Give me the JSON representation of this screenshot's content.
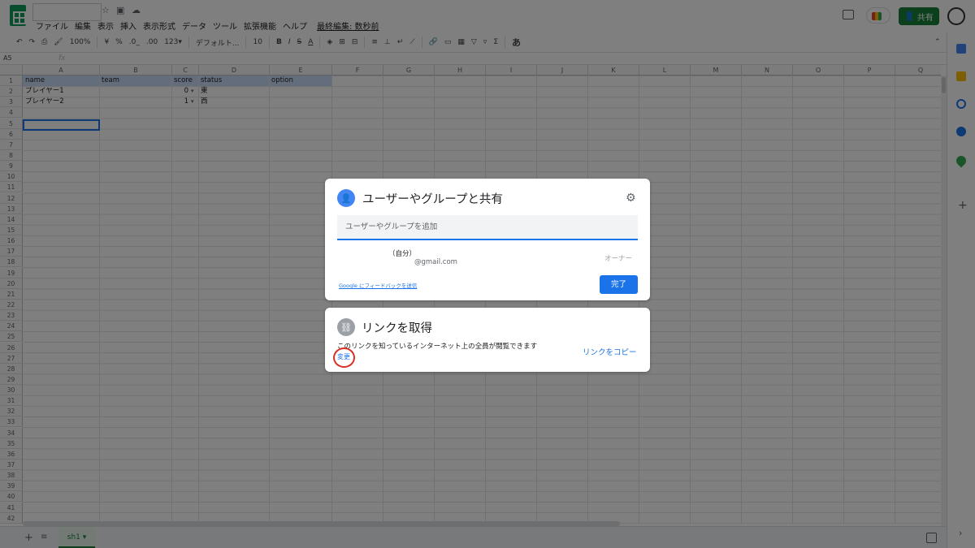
{
  "app": {
    "menu": [
      "ファイル",
      "編集",
      "表示",
      "挿入",
      "表示形式",
      "データ",
      "ツール",
      "拡張機能",
      "ヘルプ"
    ],
    "last_edit": "最終編集: 数秒前",
    "share_label": "共有"
  },
  "toolbar": {
    "zoom": "100%",
    "currency": "¥",
    "percent": "%",
    "dec_less": ".0_",
    ".00": ".00",
    "format_more": "123▾",
    "font": "デフォルト...",
    "font_size": "10",
    "bold": "B",
    "italic": "I",
    "strike": "S",
    "text_color": "A",
    "sigma": "Σ",
    "input_tool": "あ"
  },
  "formula_bar": {
    "namebox": "A5",
    "fx": "fx"
  },
  "grid": {
    "columns": [
      "A",
      "B",
      "C",
      "D",
      "E",
      "F",
      "G",
      "H",
      "I",
      "J",
      "K",
      "L",
      "M",
      "N",
      "O",
      "P",
      "Q"
    ],
    "rows": [
      "1",
      "2",
      "3",
      "4",
      "5",
      "6",
      "7",
      "8",
      "9",
      "10",
      "11",
      "12",
      "13",
      "14",
      "15",
      "16",
      "17",
      "18",
      "19",
      "20",
      "21",
      "22",
      "23",
      "24",
      "25",
      "26",
      "27",
      "28",
      "29",
      "30",
      "31",
      "32",
      "33",
      "34",
      "35",
      "36",
      "37",
      "38",
      "39",
      "40",
      "41",
      "42"
    ],
    "header_row": {
      "a": "name",
      "b": "team",
      "c": "score",
      "d": "status",
      "e": "option"
    },
    "data_rows": [
      {
        "a": "プレイヤー1",
        "c": "0",
        "d": "東"
      },
      {
        "a": "プレイヤー2",
        "c": "1",
        "d": "西"
      }
    ],
    "header_highlight": "#c9daf8"
  },
  "sheets": {
    "add": "+",
    "all": "≡",
    "tabs": [
      "sh1 ▾"
    ]
  },
  "share_dialog": {
    "title": "ユーザーやグループと共有",
    "input_placeholder": "ユーザーやグループを追加",
    "self_label": "（自分）",
    "email": "@gmail.com",
    "role": "オーナー",
    "feedback": "Google にフィードバックを送信",
    "done": "完了"
  },
  "link_dialog": {
    "title": "リンクを取得",
    "description": "このリンクを知っているインターネット上の全員が閲覧できます",
    "change": "変更",
    "copy": "リンクをコピー"
  },
  "colors": {
    "accent": "#1a73e8",
    "share_green": "#188038",
    "annotation_red": "#d93025"
  }
}
